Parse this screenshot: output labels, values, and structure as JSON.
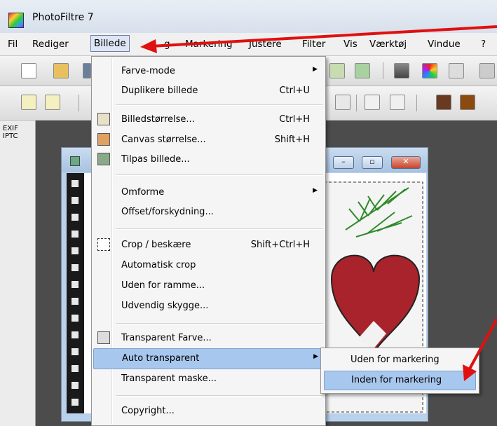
{
  "window": {
    "title": "PhotoFiltre 7"
  },
  "menubar": {
    "items": [
      "Fil",
      "Rediger",
      "Billede",
      "g",
      "Markering",
      "Justere",
      "Filter",
      "Vis",
      "Værktøj",
      "Vindue",
      "?"
    ]
  },
  "left_panel": {
    "line1": "EXIF",
    "line2": "IPTC"
  },
  "billede_menu": {
    "items": [
      {
        "label": "Farve-mode",
        "shortcut": "",
        "submenu": "▶"
      },
      {
        "label": "Duplikere billede",
        "shortcut": "Ctrl+U"
      },
      {
        "label": "Billedstørrelse...",
        "shortcut": "Ctrl+H"
      },
      {
        "label": "Canvas størrelse...",
        "shortcut": "Shift+H"
      },
      {
        "label": "Tilpas billede...",
        "shortcut": ""
      },
      {
        "label": "Omforme",
        "shortcut": "",
        "submenu": "▶"
      },
      {
        "label": "Offset/forskydning...",
        "shortcut": ""
      },
      {
        "label": "Crop / beskære",
        "shortcut": "Shift+Ctrl+H"
      },
      {
        "label": "Automatisk crop",
        "shortcut": ""
      },
      {
        "label": "Uden for ramme...",
        "shortcut": ""
      },
      {
        "label": "Udvendig skygge...",
        "shortcut": ""
      },
      {
        "label": "Transparent Farve...",
        "shortcut": ""
      },
      {
        "label": "Auto transparent",
        "shortcut": "",
        "submenu": "▶"
      },
      {
        "label": "Transparent maske...",
        "shortcut": ""
      },
      {
        "label": "Copyright...",
        "shortcut": ""
      }
    ]
  },
  "auto_transparent_submenu": {
    "items": [
      "Uden for markering",
      "Inden for markering"
    ]
  },
  "colors": {
    "menu_highlight": "#a7c7ee",
    "annotation_arrow": "#e01010"
  }
}
